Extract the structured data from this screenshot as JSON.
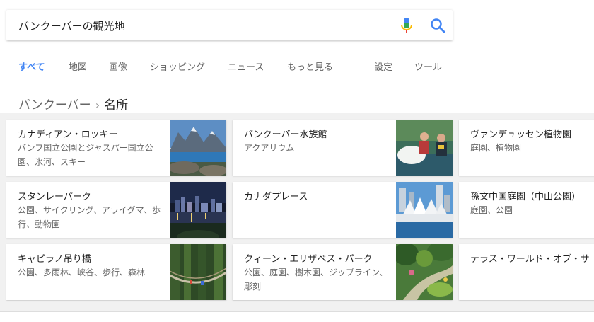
{
  "search": {
    "query": "バンクーバーの観光地",
    "mic_icon": "microphone-icon",
    "search_icon": "magnifier-icon",
    "accent": "#4285f4"
  },
  "tabs": [
    {
      "label": "すべて",
      "active": true
    },
    {
      "label": "地図"
    },
    {
      "label": "画像"
    },
    {
      "label": "ショッピング"
    },
    {
      "label": "ニュース"
    },
    {
      "label": "もっと見る"
    },
    {
      "label": "設定"
    },
    {
      "label": "ツール"
    }
  ],
  "breadcrumb": {
    "parent": "バンクーバー",
    "separator": "›",
    "current": "名所"
  },
  "cards": [
    {
      "title": "カナディアン・ロッキー",
      "subtitle": "バンフ国立公園とジャスパー国立公園、氷河、スキー",
      "thumb": "mountain-lake"
    },
    {
      "title": "バンクーバー水族館",
      "subtitle": "アクアリウム",
      "thumb": "beluga"
    },
    {
      "title": "ヴァンデュッセン植物園",
      "subtitle": "庭園、植物園"
    },
    {
      "title": "スタンレーパーク",
      "subtitle": "公園、サイクリング、アライグマ、歩行、動物園",
      "thumb": "night-skyline"
    },
    {
      "title": "カナダプレース",
      "subtitle": "",
      "thumb": "canada-place"
    },
    {
      "title": "孫文中国庭園（中山公園）",
      "subtitle": "庭園、公園"
    },
    {
      "title": "キャピラノ吊り橋",
      "subtitle": "公園、多雨林、峡谷、歩行、森林",
      "thumb": "suspension-bridge"
    },
    {
      "title": "クィーン・エリザベス・パーク",
      "subtitle": "公園、庭園、樹木園、ジップライン、彫刻",
      "thumb": "garden"
    },
    {
      "title": "テラス・ワールド・オブ・サ",
      "subtitle": ""
    }
  ]
}
